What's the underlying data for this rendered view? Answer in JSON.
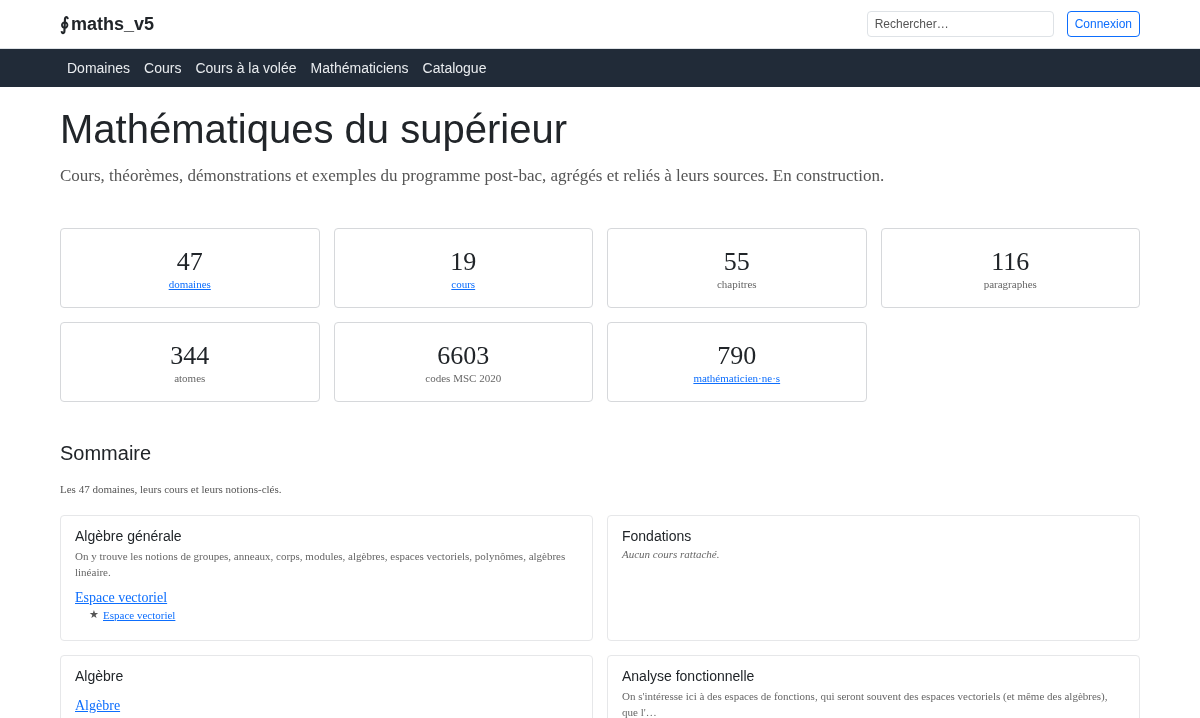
{
  "header": {
    "logo_symbol": "∮",
    "site_name": "maths_v5",
    "search": {
      "placeholder": "Rechercher…"
    },
    "login_button": "Connexion"
  },
  "nav": [
    "Domaines",
    "Cours",
    "Cours à la volée",
    "Mathématiciens",
    "Catalogue"
  ],
  "hero": {
    "title": "Mathématiques du supérieur",
    "subtitle": "Cours, théorèmes, démonstrations et exemples du programme post-bac, agrégés et reliés à leurs sources. En construction."
  },
  "stats": [
    {
      "value": "47",
      "label": "domaines",
      "link": true
    },
    {
      "value": "19",
      "label": "cours",
      "link": true
    },
    {
      "value": "55",
      "label": "chapitres",
      "link": false
    },
    {
      "value": "116",
      "label": "paragraphes",
      "link": false
    },
    {
      "value": "344",
      "label": "atomes",
      "link": false
    },
    {
      "value": "6603",
      "label": "codes MSC 2020",
      "link": false
    },
    {
      "value": "790",
      "label": "mathématicien·ne·s",
      "link": true
    }
  ],
  "summary": {
    "title": "Sommaire",
    "intro": "Les 47 domaines, leurs cours et leurs notions-clés.",
    "domains": [
      {
        "name": "Algèbre générale",
        "description": "On y trouve les notions de groupes, anneaux, corps, modules, algèbres, espaces vectoriels, polynômes, algèbres linéaire.",
        "courses": [
          {
            "title": "Espace vectoriel",
            "notions": [
              {
                "star": "★",
                "title": "Espace vectoriel"
              }
            ]
          }
        ]
      },
      {
        "name": "Fondations",
        "empty_note": "Aucun cours rattaché."
      },
      {
        "name": "Algèbre",
        "courses": [
          {
            "title": "Algèbre"
          }
        ]
      },
      {
        "name": "Analyse fonctionnelle",
        "description": "On s'intéresse ici à des espaces de fonctions, qui seront souvent des espaces vectoriels (et même des algèbres), que l'…"
      }
    ]
  }
}
